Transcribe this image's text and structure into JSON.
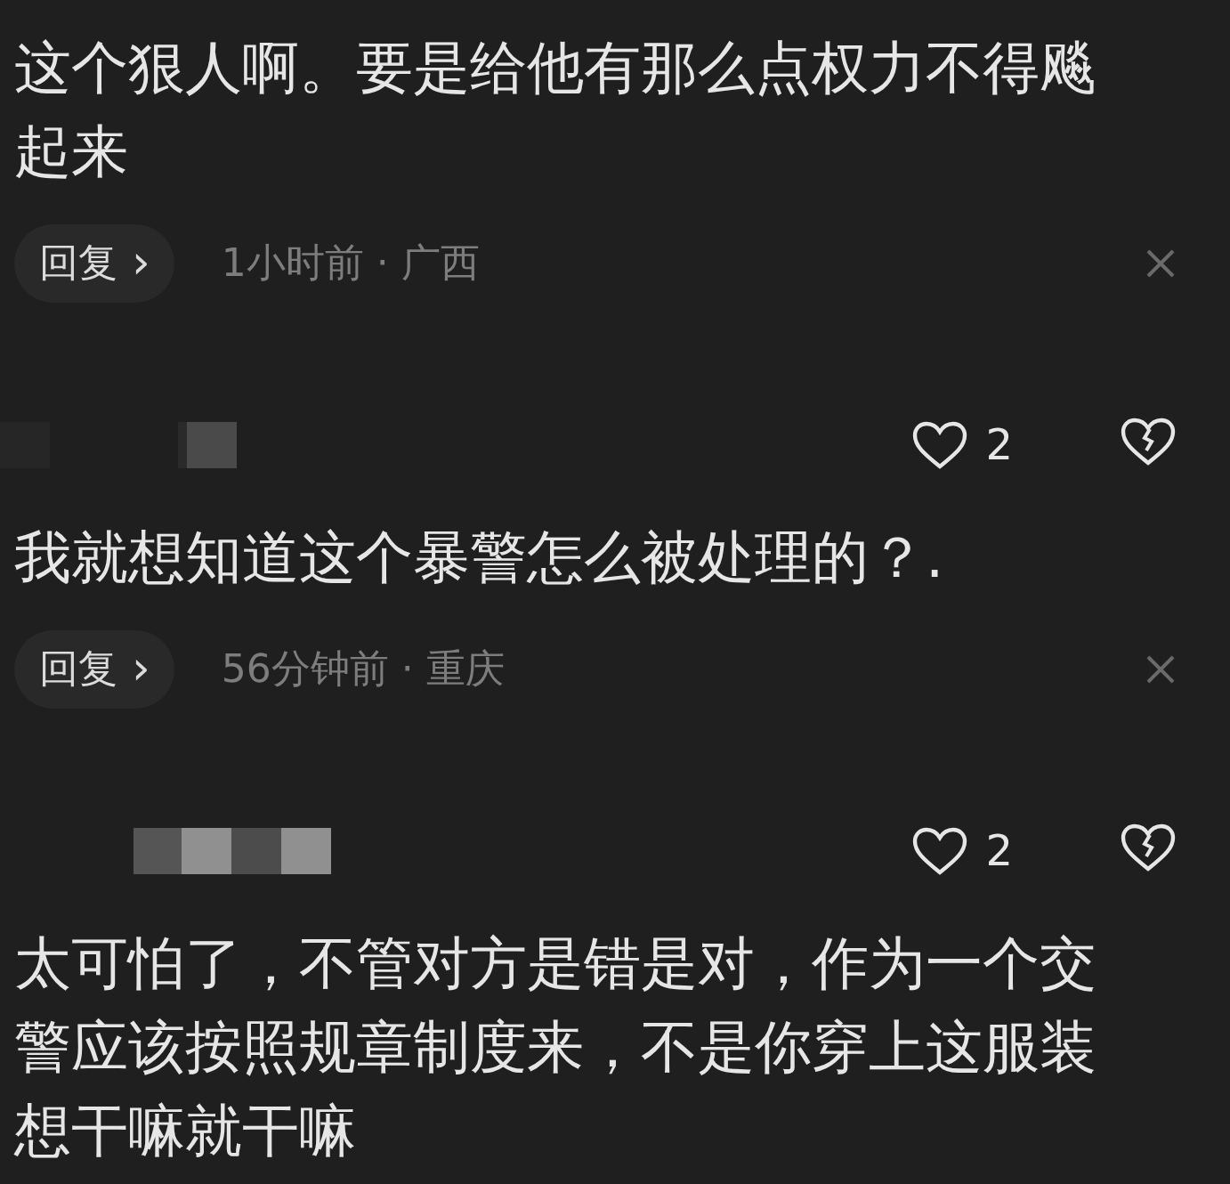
{
  "comments": [
    {
      "text": "这个狠人啊。要是给他有那么点权力不得飚起来",
      "reply": {
        "label": "回复",
        "chevron": "›",
        "meta": "1小时前 · 广西"
      }
    },
    {
      "likes": "2",
      "text": "我就想知道这个暴警怎么被处理的？.",
      "reply": {
        "label": "回复",
        "chevron": "›",
        "meta": "56分钟前 · 重庆"
      }
    },
    {
      "likes": "2",
      "text": "太可怕了，不管对方是错是对，作为一个交警应该按照规章制度来，不是你穿上这服装想干嘛就干嘛"
    }
  ]
}
